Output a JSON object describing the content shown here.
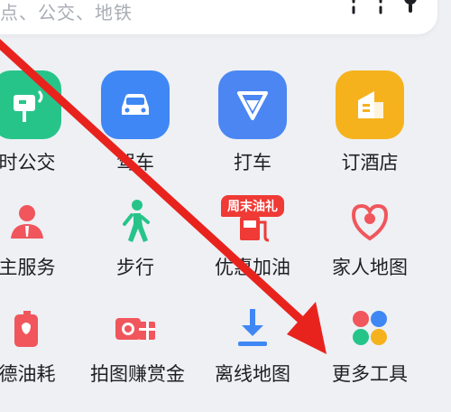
{
  "search": {
    "placeholder_text": "点、公交、地铁"
  },
  "row1": [
    {
      "name": "time-bus",
      "label": "时公交",
      "icon": "bus-stop-icon",
      "color": "#27c48a"
    },
    {
      "name": "drive",
      "label": "驾车",
      "icon": "car-icon",
      "color": "#3f87f5"
    },
    {
      "name": "taxi",
      "label": "打车",
      "icon": "taxi-v-icon",
      "color": "#4b86f3"
    },
    {
      "name": "hotel",
      "label": "订酒店",
      "icon": "hotel-building-icon",
      "color": "#f5b21c"
    }
  ],
  "row2": [
    {
      "name": "owner-service",
      "label": "主服务",
      "icon": "person-service-icon",
      "color": "#f0565c"
    },
    {
      "name": "walk",
      "label": "步行",
      "icon": "walking-person-icon",
      "color": "#27c48a"
    },
    {
      "name": "gas",
      "label": "优惠加油",
      "badge": "周末油礼",
      "icon": "fuel-pump-icon",
      "color": "#ef3a35"
    },
    {
      "name": "family-map",
      "label": "家人地图",
      "icon": "heart-location-icon",
      "color": "#f0565c"
    }
  ],
  "row3": [
    {
      "name": "fuel-consumption",
      "label": "德油耗",
      "icon": "fuel-can-icon",
      "color": "#f0565c"
    },
    {
      "name": "photo-reward",
      "label": "拍图赚赏金",
      "icon": "camera-gift-icon",
      "color": "#f0565c"
    },
    {
      "name": "offline-map",
      "label": "离线地图",
      "icon": "download-icon",
      "color": "#3f87f5"
    },
    {
      "name": "more-tools",
      "label": "更多工具",
      "icon": "four-dots-icon",
      "color": "#3f87f5"
    }
  ]
}
